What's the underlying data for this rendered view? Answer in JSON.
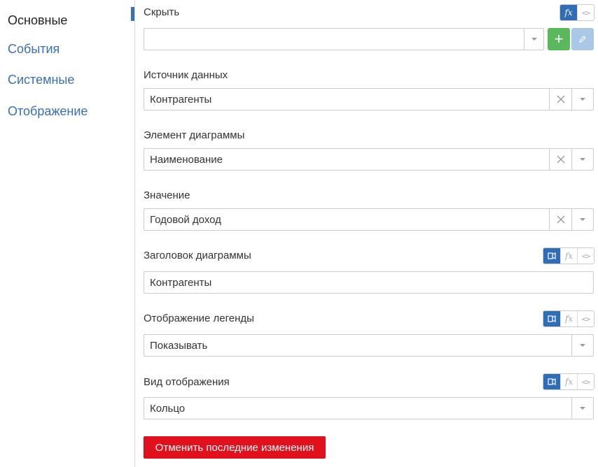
{
  "sidebar": {
    "items": [
      {
        "label": "Основные",
        "active": true
      },
      {
        "label": "События",
        "active": false
      },
      {
        "label": "Системные",
        "active": false
      },
      {
        "label": "Отображение",
        "active": false
      }
    ]
  },
  "toolbar_icons": {
    "fx": "fx",
    "code": "<>",
    "translate": "translate-icon"
  },
  "fields": {
    "hide": {
      "label": "Скрыть",
      "value": ""
    },
    "data_source": {
      "label": "Источник данных",
      "value": "Контрагенты"
    },
    "chart_element": {
      "label": "Элемент диаграммы",
      "value": "Наименование"
    },
    "value": {
      "label": "Значение",
      "value": "Годовой доход"
    },
    "chart_title": {
      "label": "Заголовок диаграммы",
      "value": "Контрагенты"
    },
    "legend_display": {
      "label": "Отображение легенды",
      "value": "Показывать"
    },
    "display_type": {
      "label": "Вид отображения",
      "value": "Кольцо"
    }
  },
  "buttons": {
    "add": "+",
    "cancel_changes": "Отменить последние изменения"
  },
  "colors": {
    "accent": "#2f6db5",
    "link": "#3a6fb0",
    "add_button": "#5cb85c",
    "edit_button": "#a9c7e6",
    "cancel_button": "#e0101c"
  }
}
